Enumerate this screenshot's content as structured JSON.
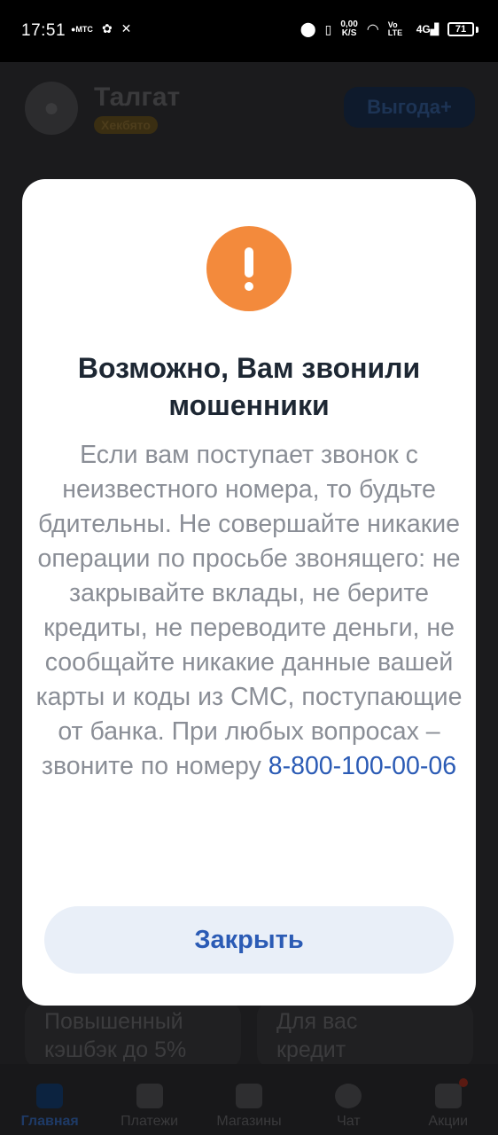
{
  "status_bar": {
    "time": "17:51",
    "left_icons": [
      "mts-bank-icon",
      "messenger-icon",
      "capcut-icon"
    ],
    "net_speed_value": "0,00",
    "net_speed_unit": "K/S",
    "network": "4G",
    "volte": "Vo LTE",
    "battery": "71"
  },
  "background": {
    "user_name": "Талгат",
    "user_badge": "Хекбято",
    "benefit_button": "Выгода+",
    "promo_cards": [
      {
        "line1": "Повышенный",
        "line2": "кэшбэк до 5%"
      },
      {
        "line1": "Для вас",
        "line2": "кредит"
      }
    ],
    "nav": [
      {
        "label": "Главная",
        "icon": "home-icon",
        "active": true
      },
      {
        "label": "Платежи",
        "icon": "payments-icon",
        "active": false
      },
      {
        "label": "Магазины",
        "icon": "shop-icon",
        "active": false
      },
      {
        "label": "Чат",
        "icon": "chat-icon",
        "active": false
      },
      {
        "label": "Акции",
        "icon": "promo-icon",
        "active": false
      }
    ]
  },
  "modal": {
    "icon": "warning-icon",
    "title": "Возможно, Вам звонили мошенники",
    "body": "Если вам поступает звонок с неизвестного номера, то будьте бдительны. Не совершайте никакие операции по просьбе звонящего: не закрывайте вклады, не берите кредиты, не переводите деньги, не сообщайте никакие данные вашей карты и коды из СМС, поступающие от банка. При любых вопросах – звоните по номеру",
    "phone": "8-800-100-00-06",
    "close_button": "Закрыть"
  },
  "colors": {
    "warning": "#f38a3c",
    "accent": "#2b5bb5",
    "button_bg": "#e9eff8",
    "title": "#1d2733",
    "body_text": "#8a8e96"
  }
}
